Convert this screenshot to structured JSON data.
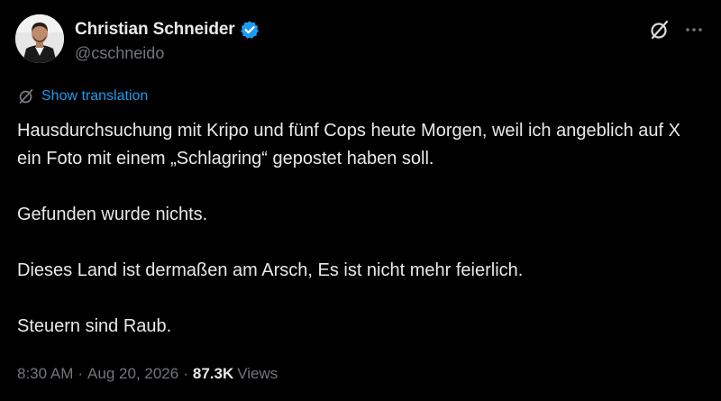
{
  "author": {
    "name": "Christian Schneider",
    "handle": "@cschneido",
    "verified": true,
    "verified_color": "#1d9bf0"
  },
  "actions": {
    "grok_icon": "grok-slash-icon",
    "more_icon": "more-dots-icon"
  },
  "translation": {
    "label": "Show translation",
    "icon": "translate-slash-icon",
    "color": "#1d9bf0"
  },
  "tweet": {
    "paragraphs": [
      "Hausdurchsuchung mit Kripo und fünf Cops heute Morgen, weil ich angeblich auf X ein Foto mit einem „Schlagring“ gepostet haben soll.",
      "Gefunden wurde nichts.",
      "Dieses Land ist dermaßen am Arsch, Es ist nicht mehr feierlich.",
      "Steuern sind Raub."
    ]
  },
  "meta": {
    "time": "8:30 AM",
    "separator": "·",
    "date": "Aug 20, 2026",
    "views_count": "87.3K",
    "views_label": "Views"
  },
  "colors": {
    "background": "#000000",
    "text": "#e7e9ea",
    "secondary": "#71767b",
    "accent": "#1d9bf0"
  }
}
